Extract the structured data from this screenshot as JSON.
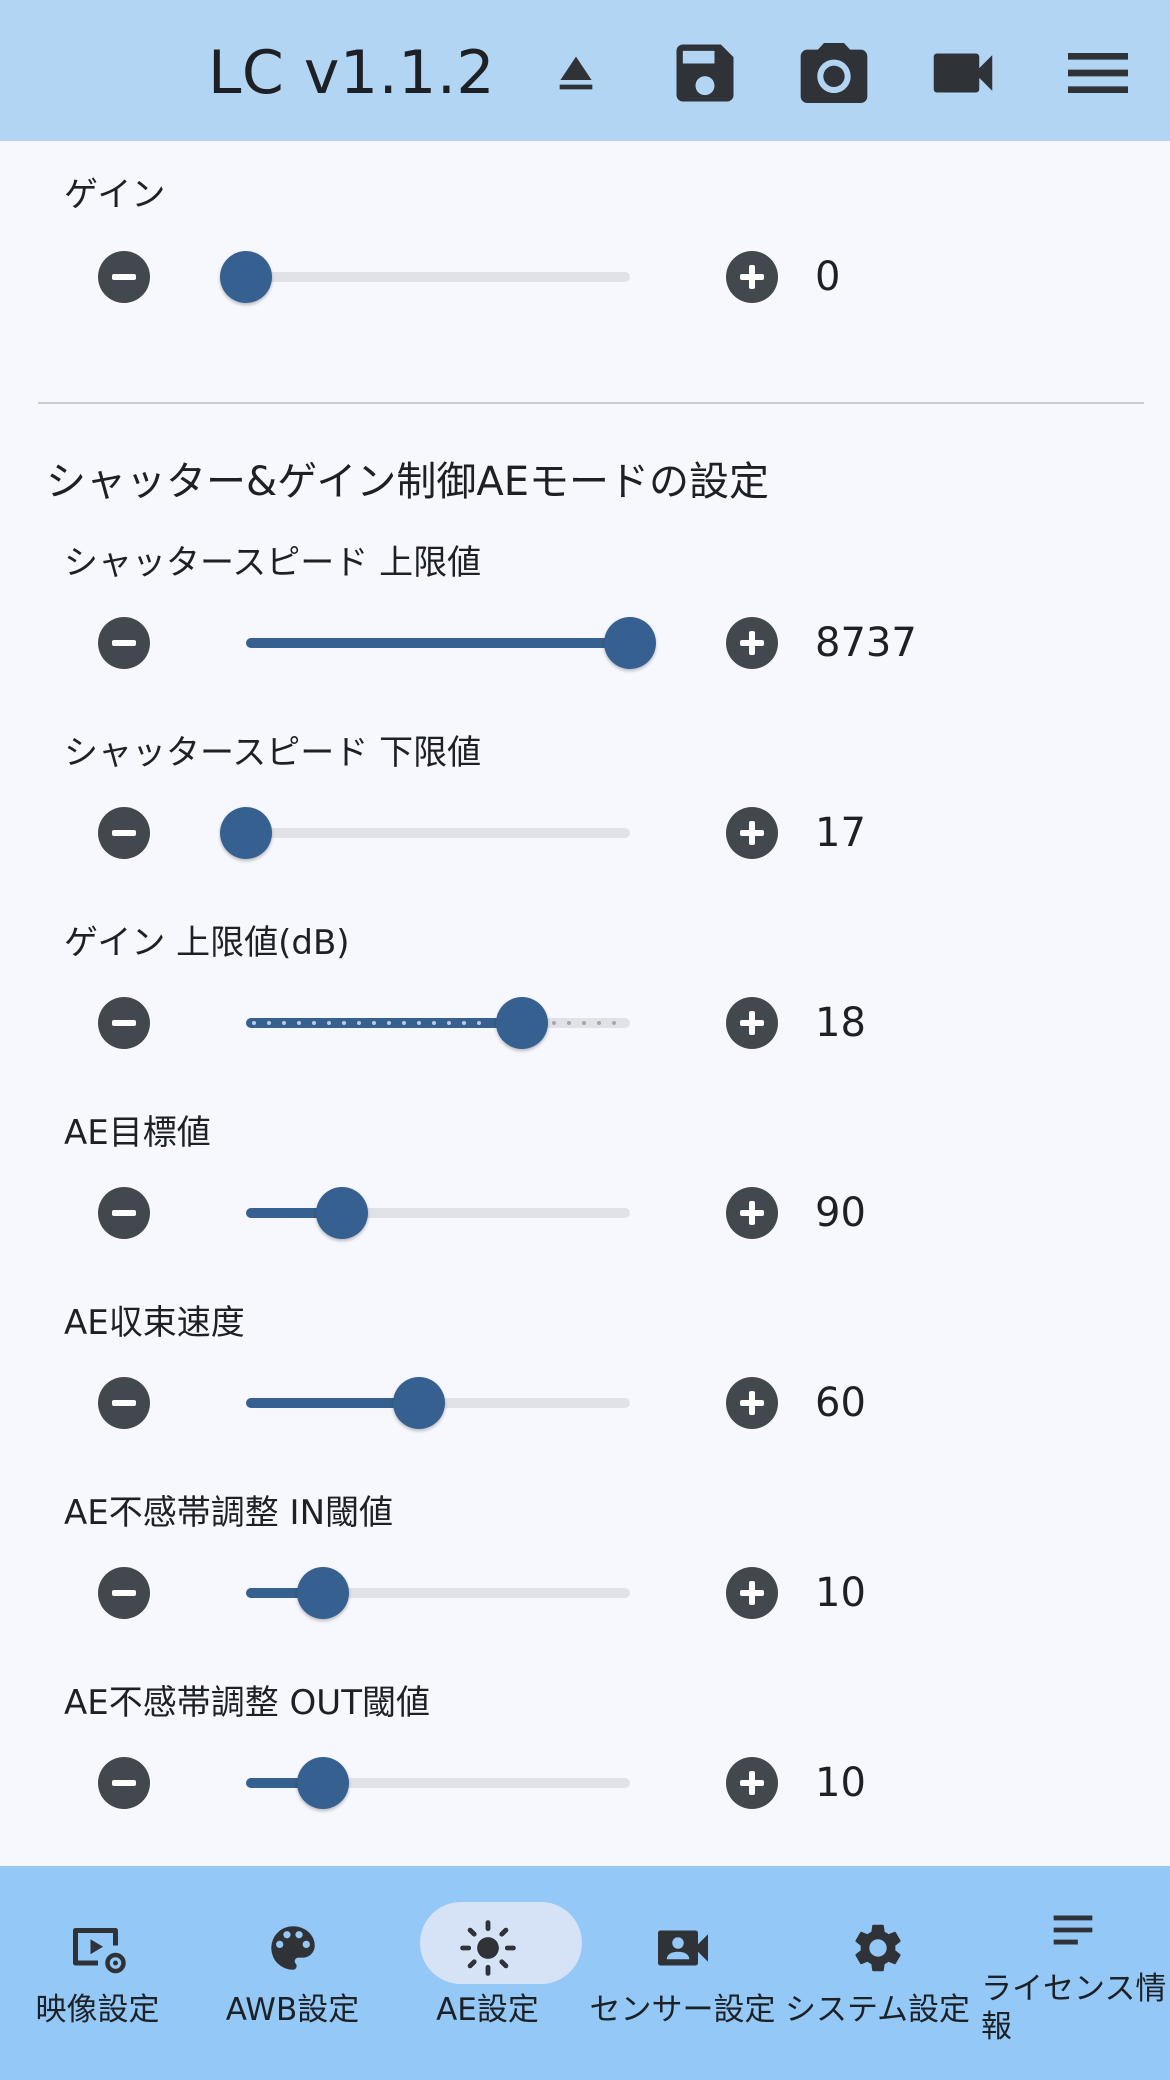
{
  "header": {
    "title": "LC v1.1.2",
    "icons": [
      "eject-icon",
      "save-icon",
      "camera-icon",
      "video-icon",
      "menu-icon"
    ]
  },
  "gain": {
    "label": "ゲイン",
    "value": "0",
    "fraction": 0.0
  },
  "section": {
    "title": "シャッター&ゲイン制御AEモードの設定"
  },
  "rows": [
    {
      "label": "シャッタースピード 上限値",
      "value": "8737",
      "fraction": 1.0,
      "dotted": false
    },
    {
      "label": "シャッタースピード 下限値",
      "value": "17",
      "fraction": 0.0,
      "dotted": false
    },
    {
      "label": "ゲイン 上限値(dB)",
      "value": "18",
      "fraction": 0.72,
      "dotted": true
    },
    {
      "label": "AE目標値",
      "value": "90",
      "fraction": 0.25,
      "dotted": false
    },
    {
      "label": "AE収束速度",
      "value": "60",
      "fraction": 0.45,
      "dotted": false
    },
    {
      "label": "AE不感帯調整 IN閾値",
      "value": "10",
      "fraction": 0.2,
      "dotted": false
    },
    {
      "label": "AE不感帯調整 OUT閾値",
      "value": "10",
      "fraction": 0.2,
      "dotted": false
    }
  ],
  "nav": {
    "active_index": 2,
    "items": [
      {
        "label": "映像設定",
        "icon": "video-settings-icon"
      },
      {
        "label": "AWB設定",
        "icon": "palette-icon"
      },
      {
        "label": "AE設定",
        "icon": "brightness-icon"
      },
      {
        "label": "センサー設定",
        "icon": "camera-person-icon"
      },
      {
        "label": "システム設定",
        "icon": "gear-icon"
      },
      {
        "label": "ライセンス情報",
        "icon": "notes-icon"
      }
    ]
  },
  "colors": {
    "header_bg": "#b3d5f4",
    "nav_bg": "#93c8f7",
    "accent": "#36608f",
    "button": "#43474e"
  }
}
